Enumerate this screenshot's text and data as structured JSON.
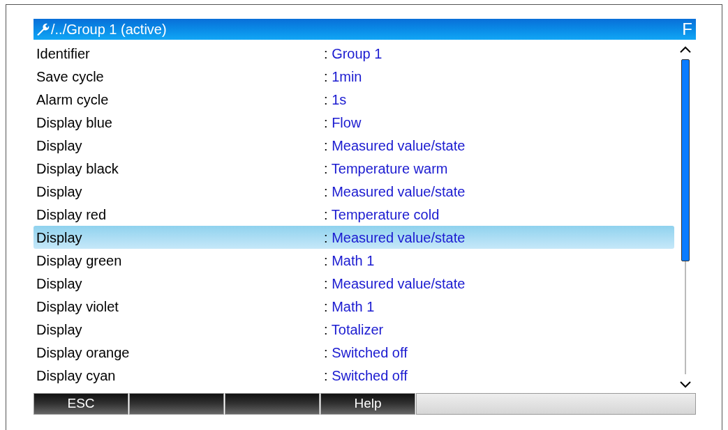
{
  "title": {
    "path": "/../Group 1 (active)",
    "badge": "F"
  },
  "rows": [
    {
      "label": "Identifier",
      "value": "Group 1",
      "selected": false
    },
    {
      "label": "Save cycle",
      "value": "1min",
      "selected": false
    },
    {
      "label": "Alarm cycle",
      "value": "1s",
      "selected": false
    },
    {
      "label": "Display blue",
      "value": "Flow",
      "selected": false
    },
    {
      "label": "Display",
      "value": "Measured value/state",
      "selected": false
    },
    {
      "label": "Display black",
      "value": "Temperature warm",
      "selected": false
    },
    {
      "label": "Display",
      "value": "Measured value/state",
      "selected": false
    },
    {
      "label": "Display red",
      "value": "Temperature cold",
      "selected": false
    },
    {
      "label": "Display",
      "value": "Measured value/state",
      "selected": true
    },
    {
      "label": "Display green",
      "value": "Math 1",
      "selected": false
    },
    {
      "label": "Display",
      "value": "Measured value/state",
      "selected": false
    },
    {
      "label": "Display violet",
      "value": "Math 1",
      "selected": false
    },
    {
      "label": "Display",
      "value": "Totalizer",
      "selected": false
    },
    {
      "label": "Display orange",
      "value": "Switched off",
      "selected": false
    },
    {
      "label": "Display cyan",
      "value": "Switched off",
      "selected": false
    }
  ],
  "separator": ":",
  "softkeys": [
    {
      "kind": "labeled",
      "label": "ESC"
    },
    {
      "kind": "blank"
    },
    {
      "kind": "blank"
    },
    {
      "kind": "labeled",
      "label": "Help"
    }
  ]
}
